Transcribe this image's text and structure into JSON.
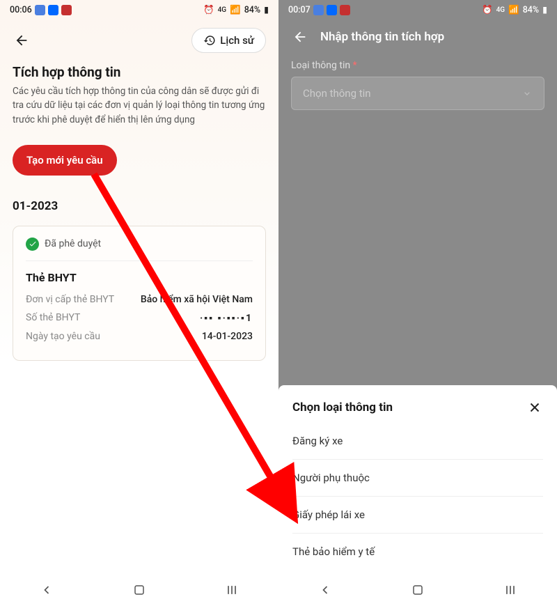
{
  "left": {
    "status": {
      "time": "00:06",
      "battery": "84%",
      "network": "4G"
    },
    "app_bar": {
      "history_label": "Lịch sử"
    },
    "title": "Tích hợp thông tin",
    "subtitle": "Các yêu cầu tích hợp thông tin của công dân sẽ được gửi đi tra cứu dữ liệu tại các đơn vị quản lý loại thông tin tương ứng trước khi phê duyệt để hiển thị lên ứng dụng",
    "create_btn": "Tạo mới yêu cầu",
    "month": "01-2023",
    "card": {
      "status": "Đã phê duyệt",
      "title": "Thẻ BHYT",
      "rows": [
        {
          "label": "Đơn vị cấp thẻ BHYT",
          "value": "Bảo hiểm xã hội Việt Nam"
        },
        {
          "label": "Số thẻ BHYT",
          "value": "·▪▪ ▪·▪▪·▪1"
        },
        {
          "label": "Ngày tạo yêu cầu",
          "value": "14-01-2023"
        }
      ]
    }
  },
  "right": {
    "status": {
      "time": "00:07",
      "battery": "84%",
      "network": "4G"
    },
    "app_bar": {
      "title": "Nhập thông tin tích hợp"
    },
    "field": {
      "label": "Loại thông tin",
      "placeholder": "Chọn thông tin"
    },
    "sheet": {
      "title": "Chọn loại thông tin",
      "items": [
        "Đăng ký xe",
        "Người phụ thuộc",
        "Giấy phép lái xe",
        "Thẻ bảo hiểm y tế"
      ]
    }
  }
}
